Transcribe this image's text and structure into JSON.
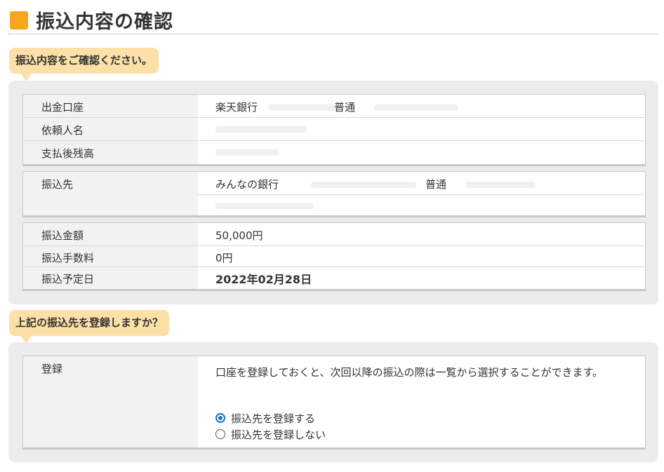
{
  "header": {
    "title": "振込内容の確認"
  },
  "confirm_section": {
    "bubble": "振込内容をご確認ください。",
    "source": {
      "account_label": "出金口座",
      "bank_name": "楽天銀行",
      "account_type": "普通",
      "requester_label": "依頼人名",
      "balance_label": "支払後残高"
    },
    "destination": {
      "label": "振込先",
      "bank_name": "みんなの銀行",
      "account_type": "普通"
    },
    "amounts": {
      "amount_label": "振込金額",
      "amount_value": "50,000円",
      "fee_label": "振込手数料",
      "fee_value": "0円",
      "date_label": "振込予定日",
      "date_value": "2022年02月28日"
    }
  },
  "register_section": {
    "bubble": "上記の振込先を登録しますか？",
    "label": "登録",
    "description": "口座を登録しておくと、次回以降の振込の際は一覧から選択することができます。",
    "options": [
      {
        "label": "振込先を登録する",
        "checked": true
      },
      {
        "label": "振込先を登録しない",
        "checked": false
      }
    ]
  },
  "colors": {
    "accent": "#f7a51b",
    "bubble": "#fce0a8",
    "panel": "#ececec",
    "radio": "#1a6ed8"
  }
}
